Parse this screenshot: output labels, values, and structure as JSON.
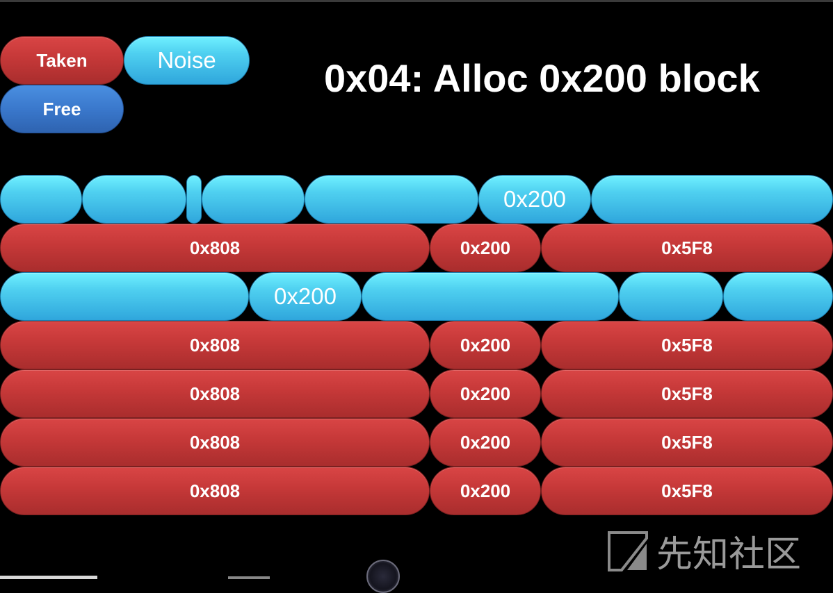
{
  "legend": {
    "taken": "Taken",
    "noise": "Noise",
    "free": "Free"
  },
  "title": "0x04: Alloc 0x200 block",
  "rows": {
    "row1": [
      "",
      "",
      "",
      "",
      "",
      "0x200",
      ""
    ],
    "row2": [
      "0x808",
      "0x200",
      "0x5F8"
    ],
    "row3": [
      "",
      "0x200",
      "",
      "",
      ""
    ],
    "row4": [
      "0x808",
      "0x200",
      "0x5F8"
    ],
    "row5": [
      "0x808",
      "0x200",
      "0x5F8"
    ],
    "row6": [
      "0x808",
      "0x200",
      "0x5F8"
    ],
    "row7": [
      "0x808",
      "0x200",
      "0x5F8"
    ]
  },
  "watermark": {
    "text": "先知社区"
  },
  "colors": {
    "taken": "#c53838",
    "noise": "#4fd0f0",
    "free": "#3a78cc",
    "background": "#000000"
  }
}
